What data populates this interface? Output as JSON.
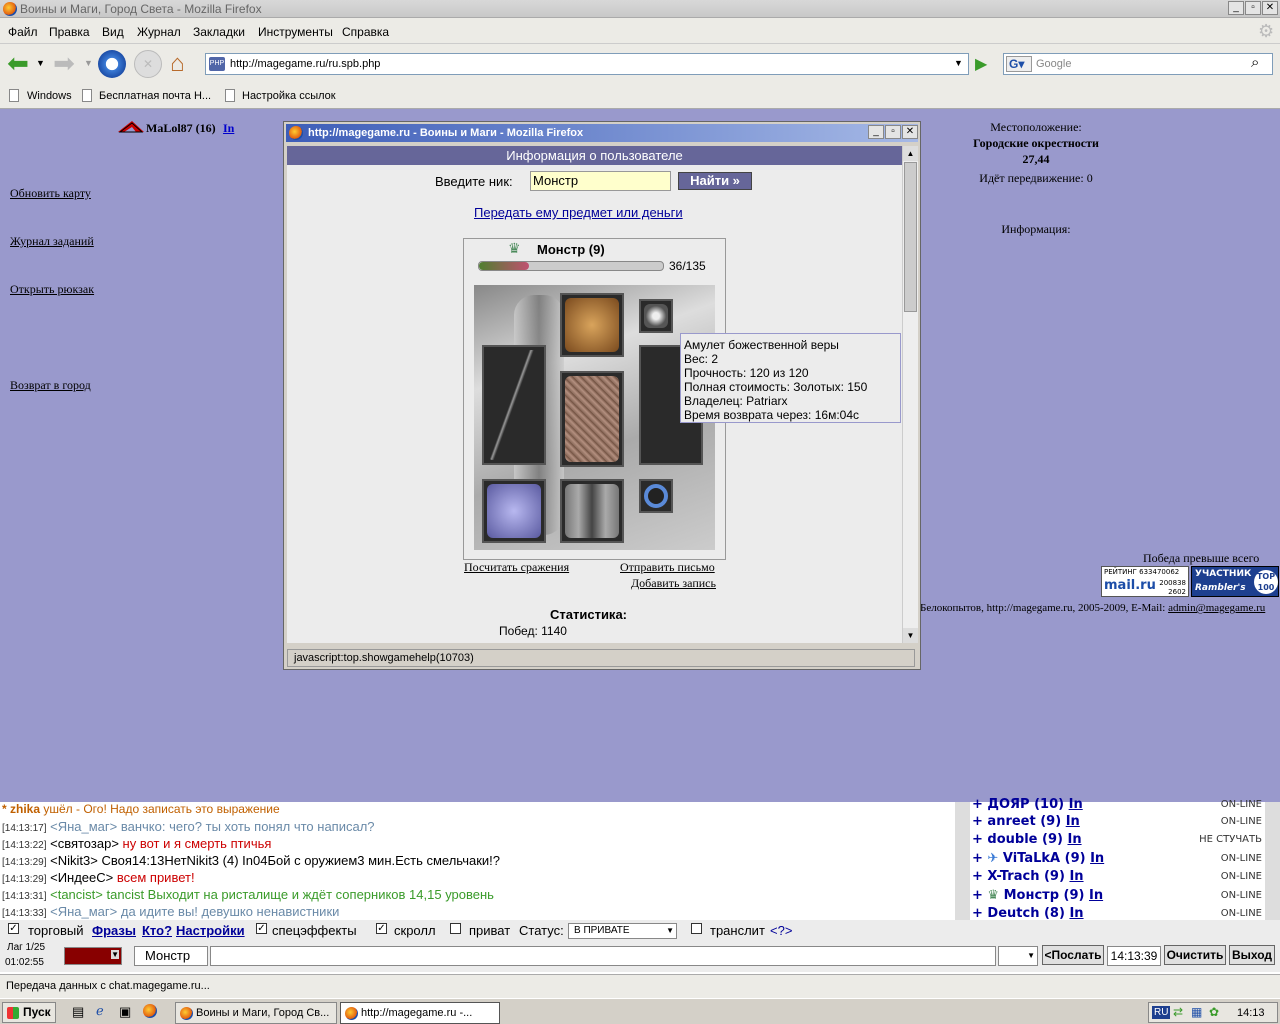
{
  "window": {
    "title": "Воины и Маги, Город Света - Mozilla Firefox"
  },
  "menu": [
    "Файл",
    "Правка",
    "Вид",
    "Журнал",
    "Закладки",
    "Инструменты",
    "Справка"
  ],
  "url": "http://magegame.ru/ru.spb.php",
  "search_placeholder": "Google",
  "bookmarks": [
    "Windows",
    "Бесплатная почта Н...",
    "Настройка ссылок"
  ],
  "player": {
    "name": "MaLol87 (16)",
    "info_link": "In"
  },
  "left_links": [
    "Обновить карту",
    "Журнал заданий",
    "Открыть рюкзак",
    "Возврат в город"
  ],
  "location": {
    "label": "Местоположение:",
    "place": "Городские окрестности",
    "coords": "27,44",
    "moving": "Идёт передвижение: 0",
    "info": "Информация:"
  },
  "footer": {
    "victory": "Победа превыше всего",
    "copyright": "Белокопытов, http://magegame.ru, 2005-2009, E-Mail: ",
    "email": "admin@magegame.ru",
    "badge1_line1": "РЕЙТИНГ 633470062",
    "badge1_brand": "mail.ru",
    "badge1_n1": "200838",
    "badge1_n2": "2602",
    "badge2_top": "УЧАСТНИК",
    "badge2_brand": "Rambler's",
    "badge2_right": "TOP 100"
  },
  "popup": {
    "title": "http://magegame.ru - Воины и Маги - Mozilla Firefox",
    "header": "Информация о пользователе",
    "nick_label": "Введите ник:",
    "nick_value": "Монстр",
    "find_button": "Найти »",
    "give_link": "Передать ему предмет или деньги",
    "char_name": "Монстр (9)",
    "hp": "36/135",
    "hp_fraction": 0.27,
    "tooltip": [
      "Амулет божественной веры",
      "Вес: 2",
      "Прочность: 120 из 120",
      "Полная стоимость: Золотых: 150",
      "Владелец: Patriarx",
      "Время возврата через: 16м:04с"
    ],
    "count_battles": "Посчитать сражения",
    "send_letter": "Отправить письмо",
    "add_record": "Добавить запись",
    "stats_title": "Статистика:",
    "wins_label": "Побед:",
    "wins_value": "1140",
    "status": "javascript:top.showgamehelp(10703)"
  },
  "chat": [
    {
      "time": "",
      "prefix": "* zhika",
      "text": "ушёл - Ого! Надо записать это выражение"
    },
    {
      "time": "[14:13:17]",
      "nick": "<Яна_маг>",
      "text": "ванчко: чего? ты хоть понял что написал?"
    },
    {
      "time": "[14:13:22]",
      "nick": "<святозар>",
      "text": "ну вот и я смерть птичья"
    },
    {
      "time": "[14:13:29]",
      "nick": "<Nikit3>",
      "text": "Своя14:13НетNikit3 (4) In04Бой с оружием3 мин.Есть смельчаки!?"
    },
    {
      "time": "[14:13:29]",
      "nick": "<ИндееС>",
      "text": "всем привет!"
    },
    {
      "time": "[14:13:31]",
      "nick": "<tancist>",
      "text": "tancist Выходит на ристалище и ждёт соперников 14,15 уровень"
    },
    {
      "time": "[14:13:33]",
      "nick": "<Яна_маг>",
      "text": "да идите вы! девушко ненавистники"
    }
  ],
  "users": [
    {
      "name": "ДОЯР (10)",
      "link": "In",
      "status": "ON-LINE"
    },
    {
      "name": "anreet (9)",
      "link": "In",
      "status": "ON-LINE"
    },
    {
      "name": "double (9)",
      "link": "In",
      "status": "НЕ СТУЧАТЬ"
    },
    {
      "name": "ViTaLkA (9)",
      "link": "In",
      "status": "ON-LINE"
    },
    {
      "name": "X-Trach (9)",
      "link": "In",
      "status": "ON-LINE"
    },
    {
      "name": "Монстр (9)",
      "link": "In",
      "status": "ON-LINE"
    },
    {
      "name": "Deutch (8)",
      "link": "In",
      "status": "ON-LINE"
    }
  ],
  "controls": {
    "trade": "торговый",
    "phrases": "Фразы",
    "who": "Кто?",
    "settings": "Настройки",
    "effects": "спецэффекты",
    "scroll": "скролл",
    "private": "приват",
    "status_label": "Статус:",
    "status_value": "В ПРИВАТЕ",
    "translit": "транслит",
    "translit_help": "<?>",
    "lag": "Лаг 1/25",
    "timer": "01:02:55",
    "to_nick": "Монстр",
    "send": "<Послать",
    "clock": "14:13:39",
    "clear": "Очистить",
    "exit": "Выход"
  },
  "statusbar": "Передача данных с chat.magegame.ru...",
  "taskbar": {
    "start": "Пуск",
    "task1": "Воины и Маги, Город Св...",
    "task2": "http://magegame.ru -...",
    "lang": "RU",
    "clock": "14:13"
  }
}
